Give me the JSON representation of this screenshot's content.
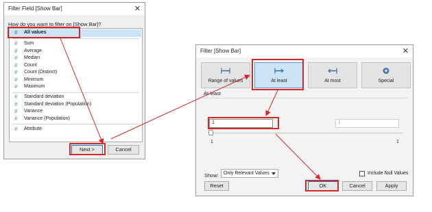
{
  "dialog1": {
    "title": "Filter Field [Show Bar]",
    "question": "How do you want to filter on [Show Bar]?",
    "items": [
      {
        "label": "All values"
      },
      {
        "label": "Sum"
      },
      {
        "label": "Average"
      },
      {
        "label": "Median"
      },
      {
        "label": "Count"
      },
      {
        "label": "Count (Distinct)"
      },
      {
        "label": "Minimum"
      },
      {
        "label": "Maximum"
      },
      {
        "label": "Standard deviation"
      },
      {
        "label": "Standard deviation (Population)"
      },
      {
        "label": "Variance"
      },
      {
        "label": "Variance (Population)"
      },
      {
        "label": "Attribute"
      }
    ],
    "next_label": "Next >",
    "cancel_label": "Cancel"
  },
  "dialog2": {
    "title": "Filter [Show Bar]",
    "modes": [
      {
        "label": "Range of values"
      },
      {
        "label": "At least"
      },
      {
        "label": "At most"
      },
      {
        "label": "Special"
      }
    ],
    "section_label": "At least",
    "min_input_value": "1",
    "max_input_value": "1",
    "range_min": "1",
    "range_max": "1",
    "show_label": "Show:",
    "show_select_value": "Only Relevant Values",
    "include_null_label": "Include Null Values",
    "reset_label": "Reset",
    "ok_label": "OK",
    "cancel_label": "Cancel",
    "apply_label": "Apply"
  },
  "colors": {
    "highlight": "#d62728",
    "selection": "#cce4f7",
    "accent": "#0078d7"
  }
}
